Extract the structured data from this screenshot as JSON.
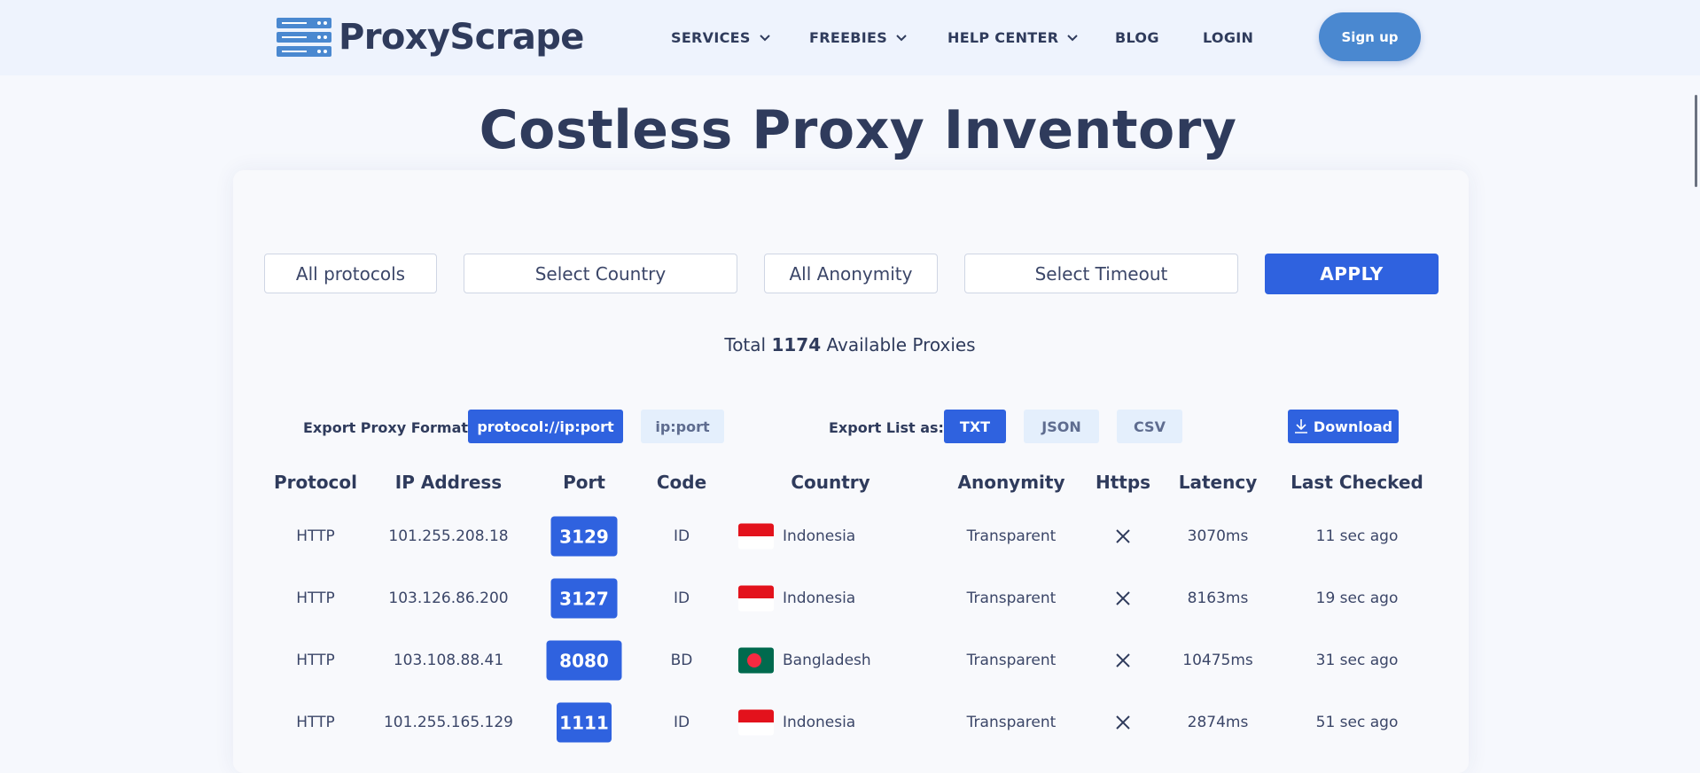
{
  "brand": {
    "name": "ProxyScrape",
    "color": "#2f3b5c",
    "accent": "#2f62df",
    "icon": "server-stack-logo-icon"
  },
  "nav": {
    "services": "SERVICES",
    "freebies": "FREEBIES",
    "help_center": "HELP CENTER",
    "blog": "BLOG",
    "login": "LOGIN",
    "signup": "Sign up"
  },
  "title": "Costless Proxy Inventory",
  "filters": {
    "protocols": "All protocols",
    "country": "Select Country",
    "anonymity": "All Anonymity",
    "timeout": "Select Timeout",
    "apply": "APPLY"
  },
  "total": {
    "prefix": "Total",
    "count": "1174",
    "suffix": "Available Proxies"
  },
  "export": {
    "format_label": "Export Proxy Format:",
    "format_options": [
      "protocol://ip:port",
      "ip:port"
    ],
    "format_selected": "protocol://ip:port",
    "list_label": "Export List as:",
    "list_options": [
      "TXT",
      "JSON",
      "CSV"
    ],
    "list_selected": "TXT",
    "download": "Download"
  },
  "table": {
    "headers": [
      "Protocol",
      "IP Address",
      "Port",
      "Code",
      "Country",
      "Anonymity",
      "Https",
      "Latency",
      "Last Checked"
    ],
    "rows": [
      {
        "protocol": "HTTP",
        "ip": "101.255.208.18",
        "port": "3129",
        "code": "ID",
        "country": "Indonesia",
        "flag": "indonesia-flag-icon",
        "anonymity": "Transparent",
        "https": "x-icon",
        "latency": "3070ms",
        "last_checked": "11 sec ago"
      },
      {
        "protocol": "HTTP",
        "ip": "103.126.86.200",
        "port": "3127",
        "code": "ID",
        "country": "Indonesia",
        "flag": "indonesia-flag-icon",
        "anonymity": "Transparent",
        "https": "x-icon",
        "latency": "8163ms",
        "last_checked": "19 sec ago"
      },
      {
        "protocol": "HTTP",
        "ip": "103.108.88.41",
        "port": "8080",
        "code": "BD",
        "country": "Bangladesh",
        "flag": "bangladesh-flag-icon",
        "anonymity": "Transparent",
        "https": "x-icon",
        "latency": "10475ms",
        "last_checked": "31 sec ago"
      },
      {
        "protocol": "HTTP",
        "ip": "101.255.165.129",
        "port": "1111",
        "code": "ID",
        "country": "Indonesia",
        "flag": "indonesia-flag-icon",
        "anonymity": "Transparent",
        "https": "x-icon",
        "latency": "2874ms",
        "last_checked": "51 sec ago"
      }
    ]
  }
}
